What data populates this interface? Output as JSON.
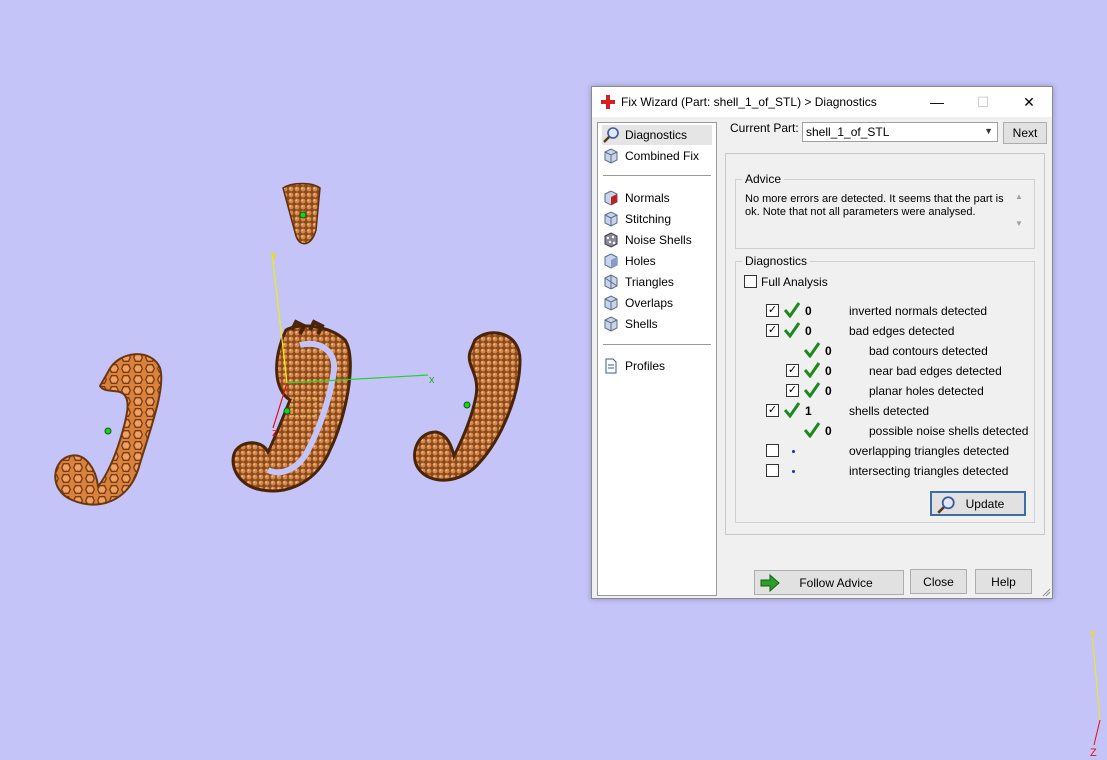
{
  "dialog": {
    "title": "Fix Wizard (Part: shell_1_of_STL) > Diagnostics",
    "minimize": "—",
    "maximize": "☐",
    "close": "✕"
  },
  "nav": {
    "items": [
      {
        "label": "Diagnostics",
        "icon": "magnifier-icon"
      },
      {
        "label": "Combined Fix",
        "icon": "cube-icon"
      },
      {
        "label": "Normals",
        "icon": "normals-cube-icon"
      },
      {
        "label": "Stitching",
        "icon": "stitching-cube-icon"
      },
      {
        "label": "Noise Shells",
        "icon": "noise-shells-icon"
      },
      {
        "label": "Holes",
        "icon": "holes-cube-icon"
      },
      {
        "label": "Triangles",
        "icon": "triangles-cube-icon"
      },
      {
        "label": "Overlaps",
        "icon": "overlaps-cube-icon"
      },
      {
        "label": "Shells",
        "icon": "shells-cube-icon"
      },
      {
        "label": "Profiles",
        "icon": "document-icon"
      }
    ]
  },
  "current_part": {
    "label": "Current Part:",
    "value": "shell_1_of_STL",
    "next": "Next"
  },
  "advice": {
    "title": "Advice",
    "text": "No more errors are detected. It seems that the part is ok. Note that not all parameters were analysed."
  },
  "diagnostics": {
    "title": "Diagnostics",
    "full_analysis": "Full Analysis",
    "rows": [
      {
        "count": "0",
        "label": "inverted normals detected",
        "checked": "✓"
      },
      {
        "count": "0",
        "label": "bad edges detected",
        "checked": "✓"
      },
      {
        "count": "0",
        "label": "bad contours detected",
        "checked": ""
      },
      {
        "count": "0",
        "label": "near bad edges detected",
        "checked": "✓"
      },
      {
        "count": "0",
        "label": "planar holes detected",
        "checked": "✓"
      },
      {
        "count": "1",
        "label": "shells detected",
        "checked": "✓"
      },
      {
        "count": "0",
        "label": "possible noise shells detected",
        "checked": ""
      },
      {
        "count": "",
        "label": "overlapping triangles detected",
        "checked": ""
      },
      {
        "count": "",
        "label": "intersecting triangles detected",
        "checked": ""
      }
    ],
    "update": "Update"
  },
  "footer": {
    "follow_advice": "Follow Advice",
    "close": "Close",
    "help": "Help"
  },
  "viewport": {
    "axes": {
      "x": "x",
      "y": "y",
      "z": "z"
    },
    "corner_axes": {
      "y": "Y",
      "z": "Z"
    }
  },
  "colors": {
    "background": "#c4c4f9",
    "part": "#e0894a",
    "check_green": "#1e8a1e",
    "axis_x": "#2ad02a",
    "axis_y": "#f0f000",
    "axis_z": "#e01010"
  }
}
